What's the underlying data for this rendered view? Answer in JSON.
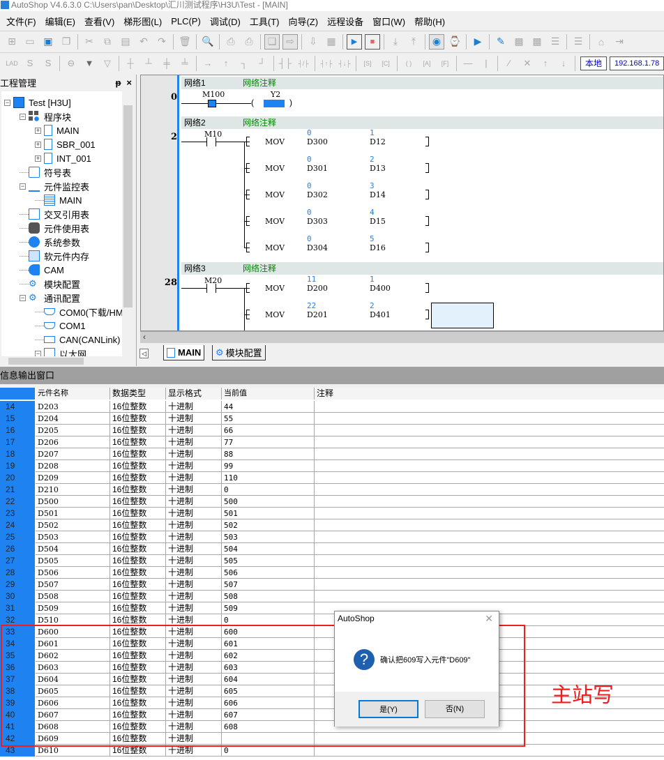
{
  "window": {
    "title": "AutoShop V4.6.3.0  C:\\Users\\pan\\Desktop\\汇川测试程序\\H3U\\Test - [MAIN]"
  },
  "menu": [
    "文件(F)",
    "编辑(E)",
    "查看(V)",
    "梯形图(L)",
    "PLC(P)",
    "调试(D)",
    "工具(T)",
    "向导(Z)",
    "远程设备",
    "窗口(W)",
    "帮助(H)"
  ],
  "toolbar": {
    "row1_icons": [
      "new-icon",
      "open-icon",
      "save-icon",
      "save-all-icon",
      "cut-icon",
      "copy-icon",
      "paste-icon",
      "undo-icon",
      "redo-icon",
      "delete-icon",
      "search-icon",
      "print-preview-icon",
      "print-icon",
      "window-cascade-icon",
      "window-export-icon",
      "download-doc-icon",
      "compare-icon",
      "run-icon",
      "stop-icon",
      "download-icon",
      "upload-icon",
      "monitor-icon",
      "trend-icon",
      "run-edit-icon",
      "edit-icon",
      "module-write-icon",
      "module-delete-icon",
      "insert-row-icon",
      "delete-row-icon",
      "test-icon",
      "login-icon"
    ],
    "row2_icons": [
      "lad-icon",
      "sfc-s-icon",
      "s-icon",
      "h-line-icon",
      "down-filled-icon",
      "down-outline-icon",
      "branch1-icon",
      "branch2-icon",
      "branch3-icon",
      "branch4-icon",
      "arrow-right-icon",
      "arrow-up-icon",
      "connect1-icon",
      "connect2-icon",
      "no-contact-icon",
      "nc-contact-icon",
      "rising-icon",
      "falling-icon",
      "set-icon",
      "counter-icon",
      "coil-icon",
      "app-icon",
      "func-icon",
      "hline-icon",
      "vline-icon",
      "del-hline-icon",
      "del-vline-icon",
      "up-icon",
      "down-icon"
    ],
    "local_label": "本地",
    "ip_label": "192.168.1.78"
  },
  "project_panel": {
    "title": "工程管理",
    "pin": "ᵽ",
    "close": "×",
    "tree": [
      {
        "label": "Test [H3U]",
        "level": 0,
        "expander": "−",
        "icon": "plc-icon"
      },
      {
        "label": "程序块",
        "level": 1,
        "expander": "−",
        "icon": "program-blocks-icon"
      },
      {
        "label": "MAIN",
        "level": 2,
        "expander": "+",
        "icon": "program-file-icon"
      },
      {
        "label": "SBR_001",
        "level": 2,
        "expander": "+",
        "icon": "program-file-icon"
      },
      {
        "label": "INT_001",
        "level": 2,
        "expander": "+",
        "icon": "program-file-icon"
      },
      {
        "label": "符号表",
        "level": 1,
        "expander": "",
        "icon": "symbol-table-icon"
      },
      {
        "label": "元件监控表",
        "level": 1,
        "expander": "−",
        "icon": "monitor-table-icon"
      },
      {
        "label": "MAIN",
        "level": 2,
        "expander": "",
        "icon": "list-icon"
      },
      {
        "label": "交叉引用表",
        "level": 1,
        "expander": "",
        "icon": "cross-ref-icon"
      },
      {
        "label": "元件使用表",
        "level": 1,
        "expander": "",
        "icon": "database-icon"
      },
      {
        "label": "系统参数",
        "level": 1,
        "expander": "",
        "icon": "globe-icon"
      },
      {
        "label": "软元件内存",
        "level": 1,
        "expander": "",
        "icon": "memory-icon"
      },
      {
        "label": "CAM",
        "level": 1,
        "expander": "",
        "icon": "cam-icon"
      },
      {
        "label": "模块配置",
        "level": 1,
        "expander": "",
        "icon": "module-config-icon"
      },
      {
        "label": "通讯配置",
        "level": 1,
        "expander": "−",
        "icon": "comm-config-icon"
      },
      {
        "label": "COM0(下载/HM",
        "level": 2,
        "expander": "",
        "icon": "serial-port-icon"
      },
      {
        "label": "COM1",
        "level": 2,
        "expander": "",
        "icon": "serial-port-icon"
      },
      {
        "label": "CAN(CANLink)",
        "level": 2,
        "expander": "",
        "icon": "network-icon"
      },
      {
        "label": "以太网",
        "level": 2,
        "expander": "−",
        "icon": "ethernet-icon"
      }
    ]
  },
  "ladder": {
    "networks": [
      {
        "name": "网络1",
        "comment": "网络注释",
        "step": "0"
      },
      {
        "name": "网络2",
        "comment": "网络注释",
        "step": "2"
      },
      {
        "name": "网络3",
        "comment": "网络注释",
        "step": "28"
      }
    ],
    "n1": {
      "contact": "M100",
      "coil": "Y2"
    },
    "n2": {
      "contact": "M10",
      "rungs": [
        {
          "op": "MOV",
          "src": "D300",
          "src_val": "0",
          "dst": "D12",
          "dst_val": "1"
        },
        {
          "op": "MOV",
          "src": "D301",
          "src_val": "0",
          "dst": "D13",
          "dst_val": "2"
        },
        {
          "op": "MOV",
          "src": "D302",
          "src_val": "0",
          "dst": "D14",
          "dst_val": "3"
        },
        {
          "op": "MOV",
          "src": "D303",
          "src_val": "0",
          "dst": "D15",
          "dst_val": "4"
        },
        {
          "op": "MOV",
          "src": "D304",
          "src_val": "0",
          "dst": "D16",
          "dst_val": "5"
        }
      ]
    },
    "n3": {
      "contact": "M20",
      "rungs": [
        {
          "op": "MOV",
          "src": "D200",
          "src_val": "11",
          "dst": "D400",
          "dst_val": "1"
        },
        {
          "op": "MOV",
          "src": "D201",
          "src_val": "22",
          "dst": "D401",
          "dst_val": "2"
        }
      ]
    }
  },
  "tabs": [
    {
      "label": "MAIN",
      "icon": "program-file-icon",
      "active": true
    },
    {
      "label": "模块配置",
      "icon": "module-config-icon",
      "active": false
    }
  ],
  "output": {
    "title": "信息输出窗口",
    "columns": [
      "",
      "元件名称",
      "数据类型",
      "显示格式",
      "当前值",
      "注释"
    ],
    "rows": [
      [
        "14",
        "D203",
        "16位整数",
        "十进制",
        "44",
        ""
      ],
      [
        "15",
        "D204",
        "16位整数",
        "十进制",
        "55",
        ""
      ],
      [
        "16",
        "D205",
        "16位整数",
        "十进制",
        "66",
        ""
      ],
      [
        "17",
        "D206",
        "16位整数",
        "十进制",
        "77",
        ""
      ],
      [
        "18",
        "D207",
        "16位整数",
        "十进制",
        "88",
        ""
      ],
      [
        "19",
        "D208",
        "16位整数",
        "十进制",
        "99",
        ""
      ],
      [
        "20",
        "D209",
        "16位整数",
        "十进制",
        "110",
        ""
      ],
      [
        "21",
        "D210",
        "16位整数",
        "十进制",
        "0",
        ""
      ],
      [
        "22",
        "D500",
        "16位整数",
        "十进制",
        "500",
        ""
      ],
      [
        "23",
        "D501",
        "16位整数",
        "十进制",
        "501",
        ""
      ],
      [
        "24",
        "D502",
        "16位整数",
        "十进制",
        "502",
        ""
      ],
      [
        "25",
        "D503",
        "16位整数",
        "十进制",
        "503",
        ""
      ],
      [
        "26",
        "D504",
        "16位整数",
        "十进制",
        "504",
        ""
      ],
      [
        "27",
        "D505",
        "16位整数",
        "十进制",
        "505",
        ""
      ],
      [
        "28",
        "D506",
        "16位整数",
        "十进制",
        "506",
        ""
      ],
      [
        "29",
        "D507",
        "16位整数",
        "十进制",
        "507",
        ""
      ],
      [
        "30",
        "D508",
        "16位整数",
        "十进制",
        "508",
        ""
      ],
      [
        "31",
        "D509",
        "16位整数",
        "十进制",
        "509",
        ""
      ],
      [
        "32",
        "D510",
        "16位整数",
        "十进制",
        "0",
        ""
      ],
      [
        "33",
        "D600",
        "16位整数",
        "十进制",
        "600",
        ""
      ],
      [
        "34",
        "D601",
        "16位整数",
        "十进制",
        "601",
        ""
      ],
      [
        "35",
        "D602",
        "16位整数",
        "十进制",
        "602",
        ""
      ],
      [
        "36",
        "D603",
        "16位整数",
        "十进制",
        "603",
        ""
      ],
      [
        "37",
        "D604",
        "16位整数",
        "十进制",
        "604",
        ""
      ],
      [
        "38",
        "D605",
        "16位整数",
        "十进制",
        "605",
        ""
      ],
      [
        "39",
        "D606",
        "16位整数",
        "十进制",
        "606",
        ""
      ],
      [
        "40",
        "D607",
        "16位整数",
        "十进制",
        "607",
        ""
      ],
      [
        "41",
        "D608",
        "16位整数",
        "十进制",
        "608",
        ""
      ],
      [
        "42",
        "D609",
        "16位整数",
        "十进制",
        "",
        ""
      ],
      [
        "43",
        "D610",
        "16位整数",
        "十进制",
        "0",
        ""
      ]
    ]
  },
  "dialog": {
    "title": "AutoShop",
    "message": "确认把609写入元件\"D609\"",
    "yes": "是(Y)",
    "no": "否(N)"
  },
  "annotation": {
    "text": "主站写",
    "color": "#f21c1c"
  }
}
